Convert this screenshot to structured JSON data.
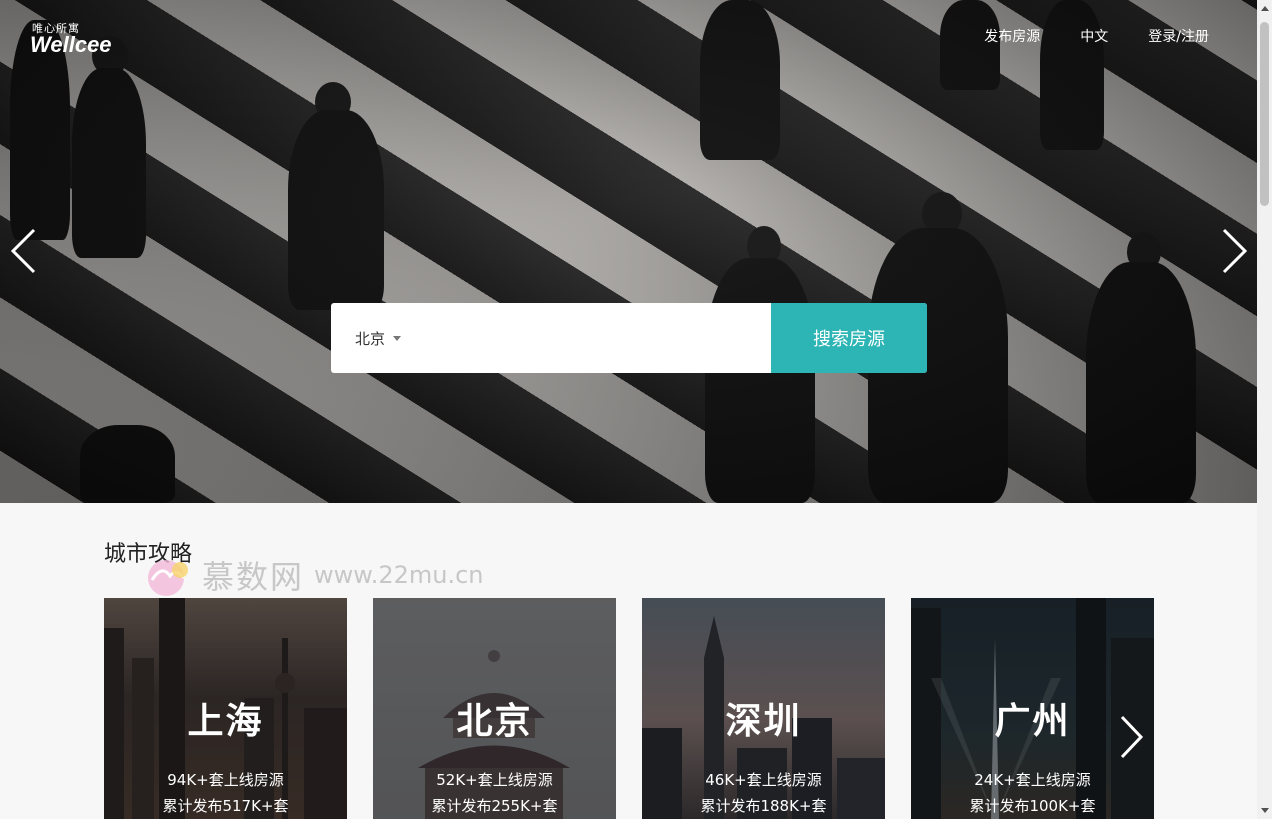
{
  "logo": {
    "small": "唯心所寓",
    "main": "Wellcee"
  },
  "nav": {
    "items": [
      {
        "label": "发布房源"
      },
      {
        "label": "中文"
      },
      {
        "label": "登录/注册"
      }
    ]
  },
  "search": {
    "city": "北京",
    "button_label": "搜索房源"
  },
  "section": {
    "title": "城市攻略"
  },
  "watermark": {
    "name": "慕数网",
    "url": "www.22mu.cn"
  },
  "cities": [
    {
      "name": "上海",
      "listings": "94K+套上线房源",
      "total": "累计发布517K+套"
    },
    {
      "name": "北京",
      "listings": "52K+套上线房源",
      "total": "累计发布255K+套"
    },
    {
      "name": "深圳",
      "listings": "46K+套上线房源",
      "total": "累计发布188K+套"
    },
    {
      "name": "广州",
      "listings": "24K+套上线房源",
      "total": "累计发布100K+套"
    }
  ],
  "colors": {
    "accent": "#2db4b5"
  }
}
